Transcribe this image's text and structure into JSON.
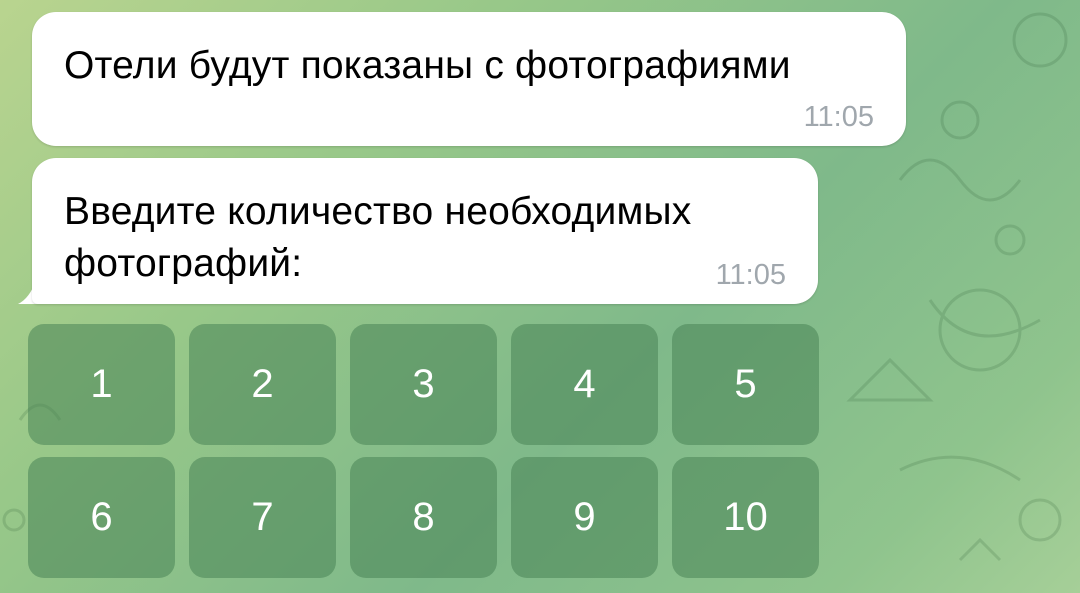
{
  "messages": [
    {
      "text": "Отели будут показаны с фотографиями",
      "time": "11:05"
    },
    {
      "line1": "Введите количество необходимых",
      "line2": "фотографий:",
      "time": "11:05"
    }
  ],
  "keyboard": {
    "buttons": [
      "1",
      "2",
      "3",
      "4",
      "5",
      "6",
      "7",
      "8",
      "9",
      "10"
    ]
  },
  "colors": {
    "bubble": "#ffffff",
    "time": "#a0a7ad",
    "key_bg": "#4a8456"
  }
}
